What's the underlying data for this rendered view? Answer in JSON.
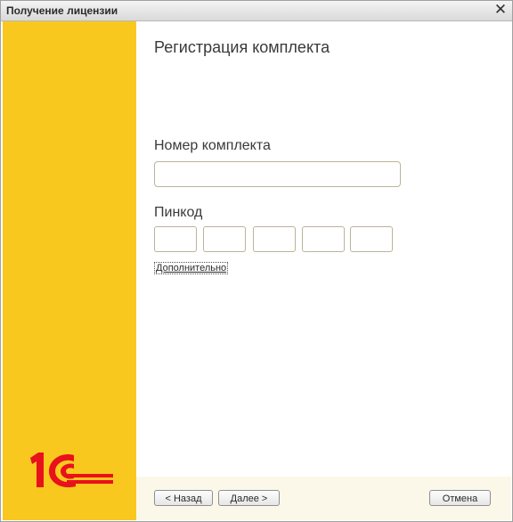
{
  "window": {
    "title": "Получение лицензии",
    "close_glyph": "✕"
  },
  "sidebar": {
    "brand_color": "#f9c81e",
    "logo_icon": "1c-logo-icon",
    "logo_color": "#e8111c"
  },
  "content": {
    "heading": "Регистрация комплекта",
    "kit_number": {
      "label": "Номер комплекта",
      "value": ""
    },
    "pincode": {
      "label": "Пинкод",
      "fields": [
        "",
        "",
        "",
        "",
        ""
      ]
    },
    "more_link": "Дополнительно"
  },
  "footer": {
    "back_label": "< Назад",
    "next_label": "Далее >",
    "cancel_label": "Отмена"
  }
}
